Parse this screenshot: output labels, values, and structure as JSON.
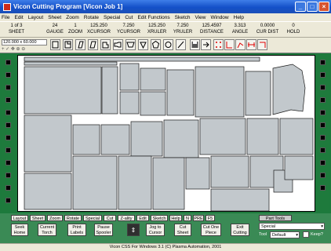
{
  "window": {
    "title": "Vicon Cutting Program [Vicon Job 1]"
  },
  "menu": [
    "File",
    "Edit",
    "Layout",
    "Sheet",
    "Zoom",
    "Rotate",
    "Special",
    "Cut",
    "Edit Functions",
    "Sketch",
    "View",
    "Window",
    "Help"
  ],
  "toolbar": {
    "sheet": {
      "value": "1 of 3",
      "label": "SHEET"
    },
    "gauge": {
      "value": "24",
      "label": "GAUGE"
    },
    "zoom": {
      "value": "1",
      "label": "ZOOM"
    },
    "xcursor": {
      "value": "125.250",
      "label": "XCURSOR"
    },
    "ycursor": {
      "value": "7.250",
      "label": "YCURSOR"
    },
    "xruler": {
      "value": "125.250",
      "label": "XRULER"
    },
    "yruler": {
      "value": "7.250",
      "label": "YRULER"
    },
    "distance": {
      "value": "125.4597",
      "label": "DISTANCE"
    },
    "angle": {
      "value": "3.313",
      "label": "ANGLE"
    },
    "curdist": {
      "value": "0.0000",
      "label": "CUR DIST"
    },
    "hold": {
      "value": "0",
      "label": "HOLD"
    },
    "sheet_size": "120.000 x 60.000"
  },
  "bottom": {
    "tabs": [
      "Layout",
      "Sheet",
      "Zoom",
      "Rotate",
      "Special",
      "Cut",
      "Z-ality",
      "Edit",
      "Sketch",
      "Help",
      "N",
      "PRE",
      "F5"
    ],
    "part_tools": "Part Tools",
    "buttons": [
      {
        "top": "Seek",
        "bottom": "Home"
      },
      {
        "top": "Current",
        "bottom": "Torch"
      },
      {
        "top": "Print",
        "bottom": "Labels"
      },
      {
        "top": "Pause",
        "bottom": "Spooler"
      },
      {
        "top": "Jog to",
        "bottom": "Cursor"
      },
      {
        "top": "Cut",
        "bottom": "Sheet"
      },
      {
        "top": "Cut One",
        "bottom": "Piece"
      },
      {
        "top": "Exit",
        "bottom": "Cutting"
      }
    ],
    "special_label": "Special",
    "tool_label": "Tool",
    "tool_value": "Default",
    "keep_label": "Keep?"
  },
  "status": "Vicon CSS For Windows 3.1 (C) Plasma Automation, 2001",
  "colors": {
    "work_bg": "#1d7a3c",
    "part_fill": "#c2c8cc",
    "title_bar": "#1450c8"
  }
}
